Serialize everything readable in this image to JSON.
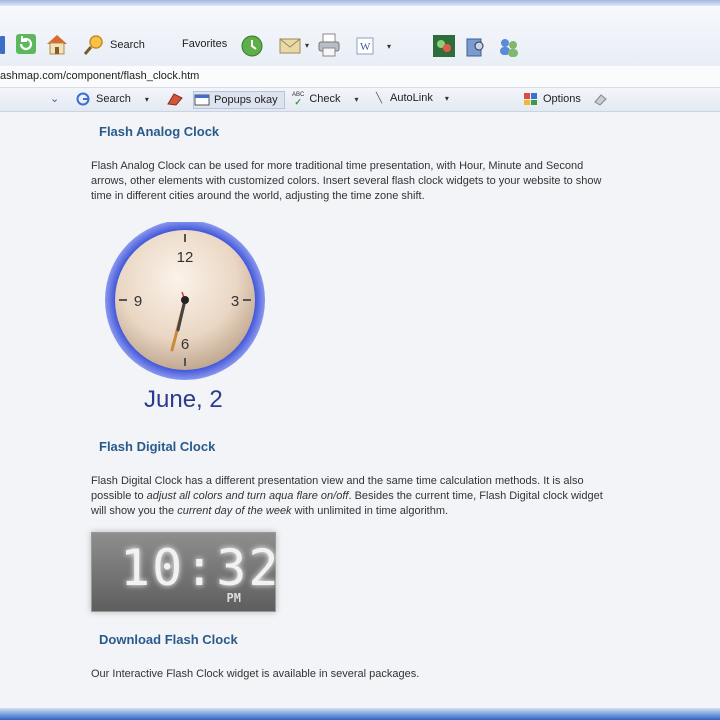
{
  "toolbar": {
    "search_label": "Search",
    "favorites_label": "Favorites"
  },
  "address": {
    "url": "ashmap.com/component/flash_clock.htm"
  },
  "links_bar": {
    "search_label": "Search",
    "popups_label": "Popups okay",
    "check_label": "Check",
    "check_badge": "ABC",
    "autolink_label": "AutoLink",
    "options_label": "Options"
  },
  "content": {
    "analog": {
      "title": "Flash Analog Clock",
      "description": "Flash Analog Clock can be used for more traditional time presentation, with Hour, Minute and Second arrows, other elements with customized colors. Insert several flash clock widgets to your website to show time in different cities around the world, adjusting the time zone shift.",
      "clock": {
        "numerals": [
          "12",
          "3",
          "6",
          "9"
        ],
        "date": "June, 2"
      }
    },
    "digital": {
      "title": "Flash Digital Clock",
      "desc_part1": "Flash Digital Clock has a different presentation view and the same time calculation methods. It is also possible to ",
      "desc_em1": "adjust all colors and turn aqua flare on/off",
      "desc_part2": ". Besides the current time, Flash Digital clock widget will show you the ",
      "desc_em2": "current day of the week",
      "desc_part3": " with unlimited in time algorithm.",
      "time": "10:32",
      "ampm": "PM"
    },
    "download": {
      "title": "Download Flash Clock",
      "description": "Our Interactive Flash Clock widget is available in several packages."
    }
  }
}
